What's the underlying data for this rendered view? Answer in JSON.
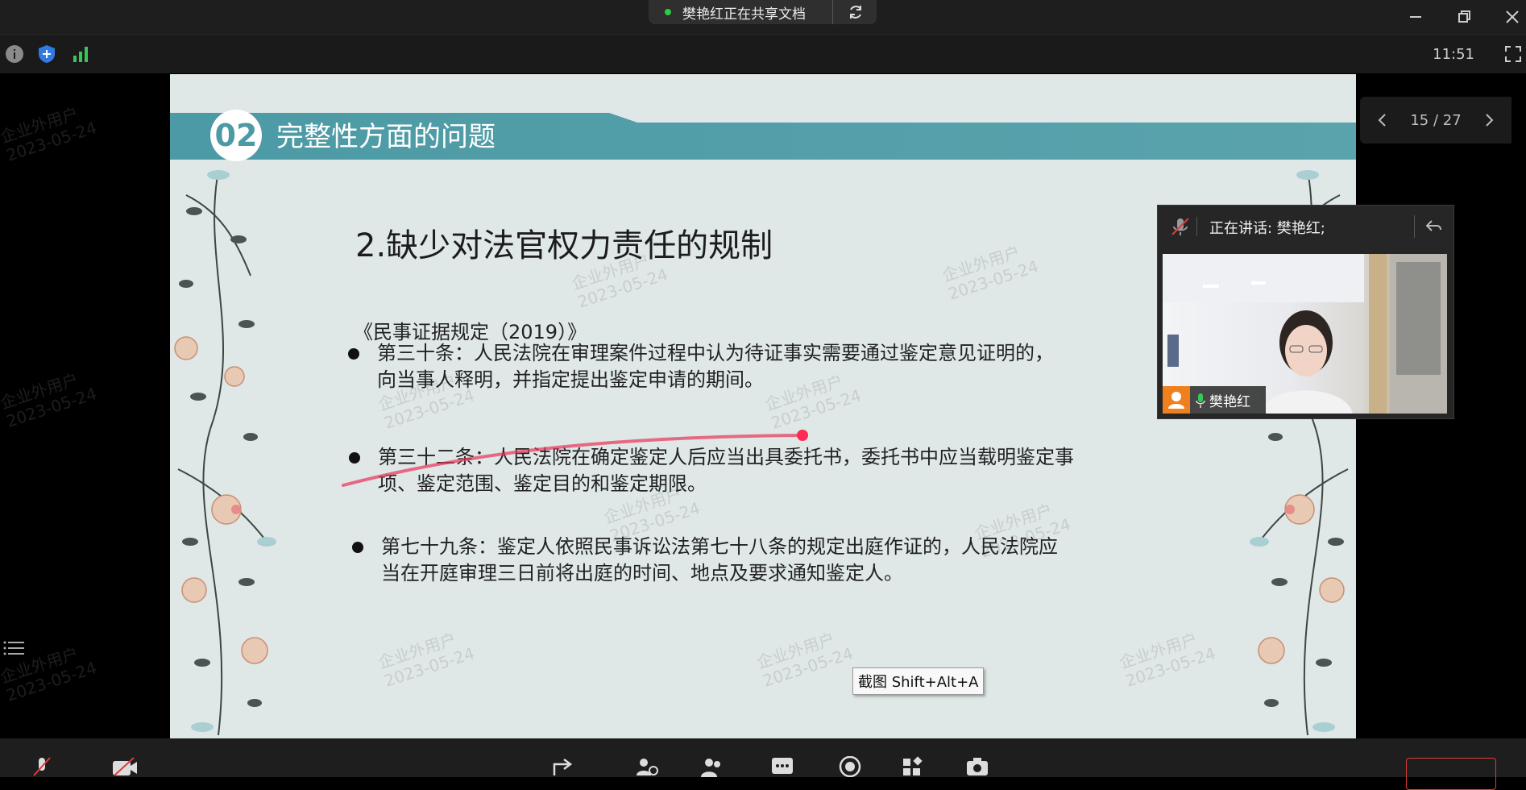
{
  "app": {
    "share_status": "樊艳红正在共享文档",
    "clock": "11:51"
  },
  "slide": {
    "section_number": "02",
    "section_title": "完整性方面的问题",
    "heading": "2.缺少对法官权力责任的规制",
    "reference": "《民事证据规定（2019）》",
    "bullets": [
      {
        "line1": "第三十条：人民法院在审理案件过程中认为待证事实需要通过鉴定意见证明的，",
        "line2": "向当事人释明，并指定提出鉴定申请的期间。"
      },
      {
        "line1": "第三十二条：人民法院在确定鉴定人后应当出具委托书，委托书中应当载明鉴定事",
        "line2": "项、鉴定范围、鉴定目的和鉴定期限。"
      },
      {
        "line1": "第七十九条：鉴定人依照民事诉讼法第七十八条的规定出庭作证的，人民法院应",
        "line2": "当在开庭审理三日前将出庭的时间、地点及要求通知鉴定人。"
      }
    ],
    "watermark_line1": "企业外用户",
    "watermark_line2": "2023-05-24"
  },
  "pager": {
    "text": "15 / 27"
  },
  "tooltip": {
    "text": "截图 Shift+Alt+A"
  },
  "video": {
    "speaking_label": "正在讲话: 樊艳红;",
    "participant_name": "樊艳红"
  },
  "colors": {
    "accent": "#4c9aa5",
    "end_button": "#e03a3a",
    "annotation": "#e8335a"
  }
}
